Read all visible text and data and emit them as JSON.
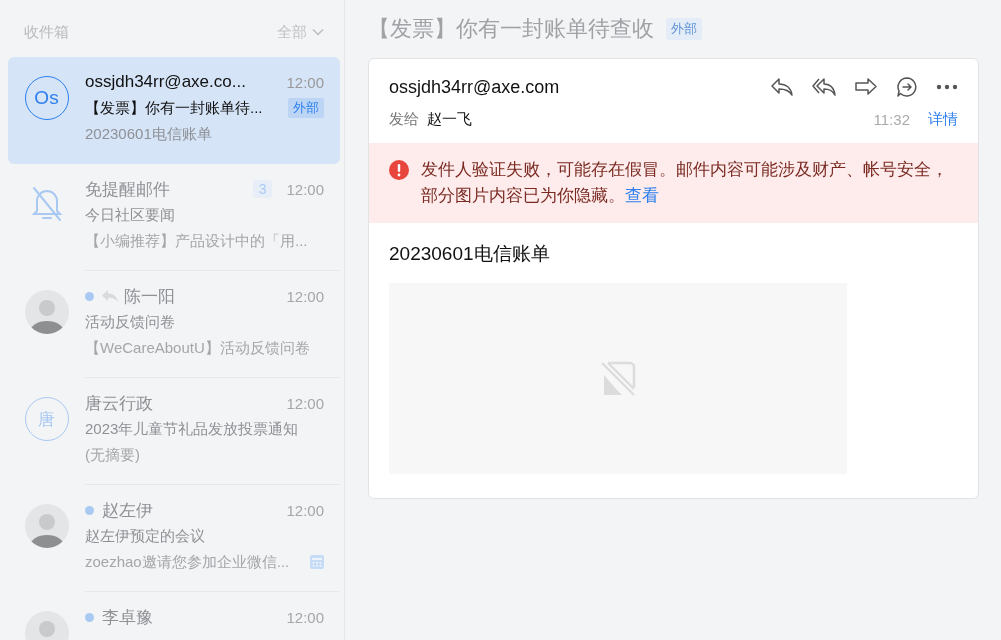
{
  "sidebar": {
    "title": "收件箱",
    "filter": "全部"
  },
  "mails": [
    {
      "avatar": {
        "kind": "initials",
        "text": "Os"
      },
      "sender": "ossjdh34rr@axe.co...",
      "time": "12:00",
      "subject": "【发票】你有一封账单待...",
      "tag": "外部",
      "preview": "20230601电信账单",
      "selected": true,
      "unread": false,
      "replied": false,
      "calendar": false
    },
    {
      "avatar": {
        "kind": "mute"
      },
      "sender": "免提醒邮件",
      "count": "3",
      "time": "12:00",
      "subject": "今日社区要闻",
      "preview": "【小编推荐】产品设计中的「用...",
      "selected": false,
      "unread": false,
      "replied": false,
      "calendar": false
    },
    {
      "avatar": {
        "kind": "photo"
      },
      "sender": "陈一阳",
      "time": "12:00",
      "subject": "活动反馈问卷",
      "preview": "【WeCareAboutU】活动反馈问卷",
      "selected": false,
      "unread": true,
      "replied": true,
      "calendar": false
    },
    {
      "avatar": {
        "kind": "initials",
        "text": "唐"
      },
      "sender": "唐云行政",
      "time": "12:00",
      "subject": "2023年儿童节礼品发放投票通知",
      "preview": "(无摘要)",
      "selected": false,
      "unread": false,
      "replied": false,
      "calendar": false
    },
    {
      "avatar": {
        "kind": "photo"
      },
      "sender": "赵左伊",
      "time": "12:00",
      "subject": "赵左伊预定的会议",
      "preview": "zoezhao邀请您参加企业微信...",
      "selected": false,
      "unread": true,
      "replied": false,
      "calendar": true
    },
    {
      "avatar": {
        "kind": "photo"
      },
      "sender": "李卓豫",
      "time": "12:00",
      "selected": false,
      "unread": true,
      "replied": false,
      "calendar": false
    }
  ],
  "reader": {
    "title": "【发票】你有一封账单待查收",
    "tag": "外部",
    "from": "ossjdh34rr@axe.com",
    "to_label": "发给",
    "to": "赵一飞",
    "time": "11:32",
    "details": "详情",
    "warning": {
      "text": "发件人验证失败，可能存在假冒。邮件内容可能涉及财产、帐号安全，部分图片内容已为你隐藏。",
      "link": "查看"
    },
    "body_title": "20230601电信账单"
  }
}
